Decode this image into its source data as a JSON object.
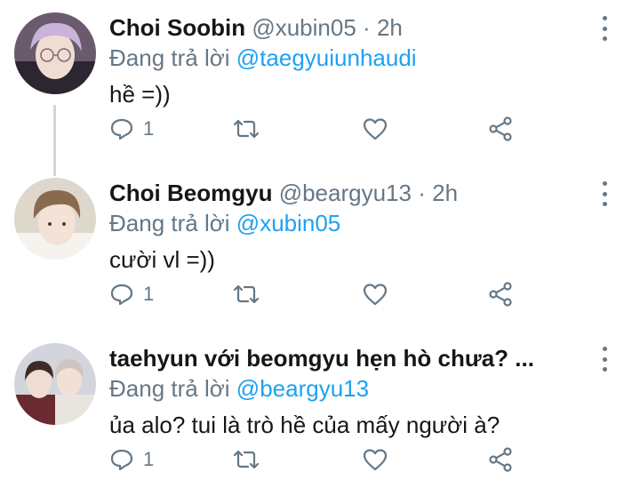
{
  "tweets": [
    {
      "name": "Choi Soobin",
      "handle": "@xubin05",
      "separator": "·",
      "time": "2h",
      "reply_prefix": "Đang trả lời",
      "reply_to": "@taegyuiunhaudi",
      "text": "hề =))",
      "reply_count": "1",
      "avatar_colors": {
        "bg": "#6a5a6e",
        "hair": "#c9b3d8",
        "face": "#f1dcd4"
      }
    },
    {
      "name": "Choi Beomgyu",
      "handle": "@beargyu13",
      "separator": "·",
      "time": "2h",
      "reply_prefix": "Đang trả lời",
      "reply_to": "@xubin05",
      "text": "cười vl =))",
      "reply_count": "1",
      "avatar_colors": {
        "bg": "#ded8cc",
        "hair": "#8a6a4e",
        "face": "#f4e2d6"
      }
    },
    {
      "name": "taehyun với beomgyu hẹn hò chưa? ...",
      "handle": "",
      "separator": "",
      "time": "",
      "reply_prefix": "Đang trả lời",
      "reply_to": "@beargyu13",
      "text": "ủa alo? tui là trò hề của mấy người à?",
      "reply_count": "1",
      "avatar_colors": {
        "bg": "#d2d6dc",
        "hair": "#3a2c28",
        "face": "#f0dcd2"
      }
    }
  ],
  "colors": {
    "link": "#1da1f2",
    "secondary": "#657786",
    "thread_line": "#ccd6dd"
  },
  "icons": [
    "reply-icon",
    "retweet-icon",
    "like-icon",
    "share-icon",
    "more-options-icon"
  ]
}
